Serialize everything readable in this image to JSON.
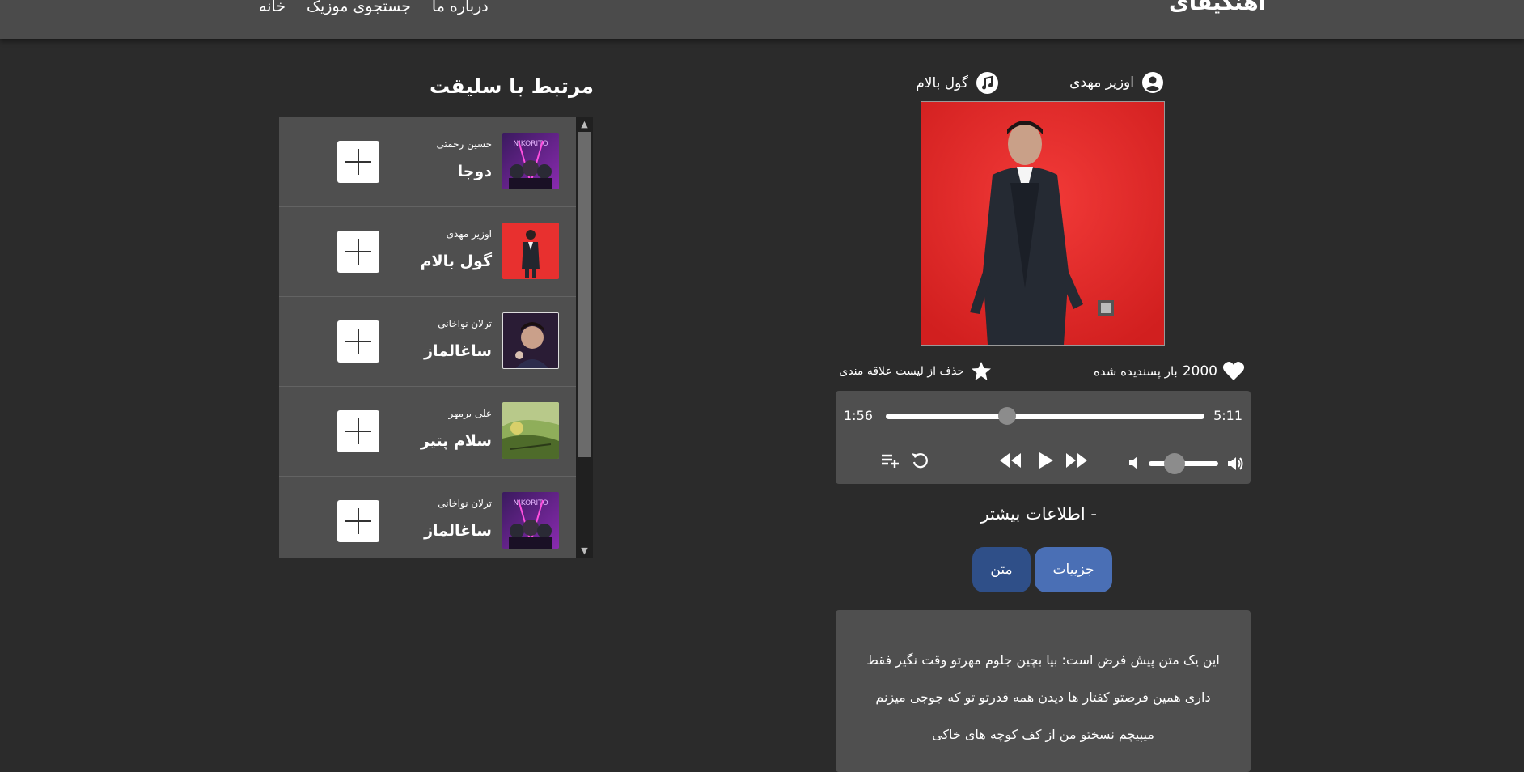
{
  "header": {
    "brand": "آهنگیفای",
    "nav": [
      "خانه",
      "جستجوی موزیک",
      "درباره ما"
    ]
  },
  "related": {
    "title": "مرتبط با سلیقت",
    "items": [
      {
        "artist": "حسین رحمتی",
        "song": "دوجا",
        "cover": "purple-group"
      },
      {
        "artist": "اوزیر مهدی",
        "song": "گول بالام",
        "cover": "red-suit"
      },
      {
        "artist": "ترلان نواخانی",
        "song": "ساغالماز",
        "cover": "portrait"
      },
      {
        "artist": "علی برمهر",
        "song": "سلام پتیر",
        "cover": "landscape"
      },
      {
        "artist": "ترلان نواخانی",
        "song": "ساغالماز",
        "cover": "purple-group"
      }
    ]
  },
  "song": {
    "artist": "اوزیر مهدی",
    "title": "گول بالام",
    "likes_count": "2000",
    "likes_suffix": "بار پسندیده شده",
    "fav_label": "حذف از لیست علاقه مندی"
  },
  "player": {
    "current_time": "1:56",
    "duration": "5:11",
    "progress": 0.38,
    "volume": 0.37
  },
  "more_info": "- اطلاعات بیشتر",
  "buttons": {
    "details": "جزییات",
    "lyrics": "متن"
  },
  "lyrics": [
    "این یک متن پیش فرض است: بیا بچین جلوم مهرتو وقت نگیر فقط",
    "داری همین فرصتو کفتار ها دیدن همه قدرتو تو که جوجی میزنم",
    "میپیچم نسختو من از کف کوچه های خاکی"
  ],
  "colors": {
    "accent": "#4a6fb5",
    "accent_dark": "#2f4f88",
    "panel": "#4f4f4f",
    "background": "#2b2b2b"
  }
}
